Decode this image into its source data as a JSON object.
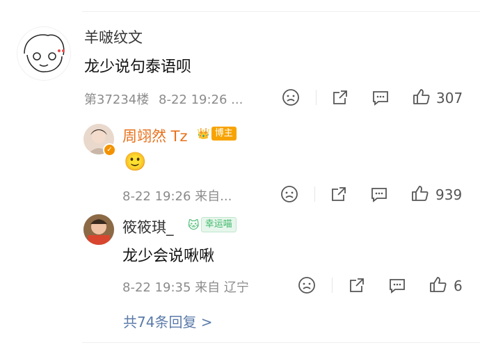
{
  "comment": {
    "username": "羊啵纹文",
    "text": "龙少说句泰语呗",
    "floor": "第37234楼",
    "time": "8-22 19:26 ...",
    "likes": "307"
  },
  "replies": [
    {
      "username": "周翊然 Tz",
      "badge": "博主",
      "emoji": "🙂",
      "time": "8-22 19:26 来自...",
      "likes": "939"
    },
    {
      "username": "筱筱琪_",
      "badge": "幸运喵",
      "text": "龙少会说啾啾",
      "time": "8-22 19:35 来自 辽宁",
      "likes": "6"
    }
  ],
  "more_replies": "共74条回复 >",
  "colors": {
    "link": "#5a7aa8",
    "badge_host": "#f7a300",
    "badge_lucky": "#3fb96a",
    "verified": "#f39200"
  }
}
